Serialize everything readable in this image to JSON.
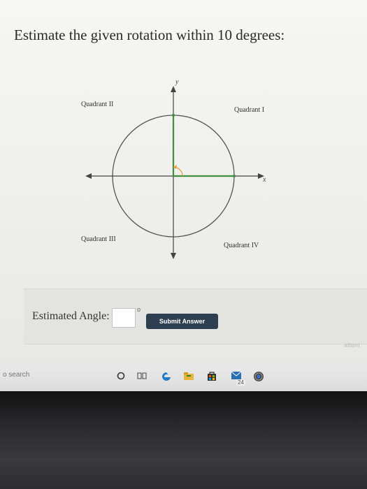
{
  "question": {
    "text": "Estimate the given rotation within 10 degrees:"
  },
  "graph": {
    "y_axis_label": "y",
    "x_axis_label": "x",
    "quadrant_labels": {
      "q1": "Quadrant I",
      "q2": "Quadrant II",
      "q3": "Quadrant III",
      "q4": "Quadrant IV"
    },
    "ray_color": "#3f8f3f",
    "angle_arc_color": "#e0a030"
  },
  "answer": {
    "label": "Estimated Angle:",
    "input_value": "",
    "degree_symbol": "o",
    "submit_label": "Submit Answer"
  },
  "attempt_text": "attem",
  "taskbar": {
    "search_text": "o search",
    "notification_count": "24",
    "icons": [
      "cortana-circle-icon",
      "task-view-icon",
      "edge-browser-icon",
      "file-explorer-icon",
      "store-icon",
      "mail-icon",
      "chrome-icon"
    ]
  }
}
